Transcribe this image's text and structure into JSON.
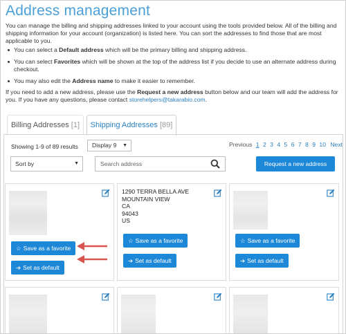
{
  "page": {
    "title": "Address management",
    "intro": "You can manage the billing and shipping addresses linked to your account using the tools provided below. All of the billing and shipping information for your account (organization) is listed here. You can sort the addresses to find those that are most applicable to you.",
    "bullets": [
      {
        "pre": "You can select a ",
        "bold": "Default address",
        "post": " which will be the primary billing and shipping address."
      },
      {
        "pre": "You can select ",
        "bold": "Favorites",
        "post": " which will be shown at the top of the address list if you decide to use an alternate address during checkout."
      },
      {
        "pre": "You may also edit the ",
        "bold": "Address name",
        "post": " to make it easier to remember."
      }
    ],
    "request_pre": "If you need to add a new address, please use the ",
    "request_bold": "Request a new address",
    "request_mid": " button below and our team will add the address for you. If you have any questions, please contact ",
    "request_email": "storehelpers@takarabio.com",
    "request_end": "."
  },
  "tabs": {
    "billing_label": "Billing Addresses",
    "billing_count": "[1]",
    "shipping_label": "Shipping Addresses",
    "shipping_count": "[89]"
  },
  "toolbar": {
    "showing": "Showing 1-9 of 89 results",
    "display": "Display 9",
    "sort": "Sort by",
    "search_placeholder": "Search address",
    "request_button": "Request a new address"
  },
  "pager": {
    "previous": "Previous",
    "pages": [
      "1",
      "2",
      "3",
      "4",
      "5",
      "6",
      "7",
      "8",
      "9",
      "10"
    ],
    "next": "Next"
  },
  "cards": {
    "favorite_label": "Save as a favorite",
    "default_label": "Set as default",
    "middle_address": [
      "1290 TERRA BELLA AVE",
      "MOUNTAIN VIEW",
      "CA",
      "94043",
      "US"
    ]
  },
  "colors": {
    "accent": "#1e88d8",
    "title": "#4a9fd6",
    "arrow": "#d9534f"
  }
}
